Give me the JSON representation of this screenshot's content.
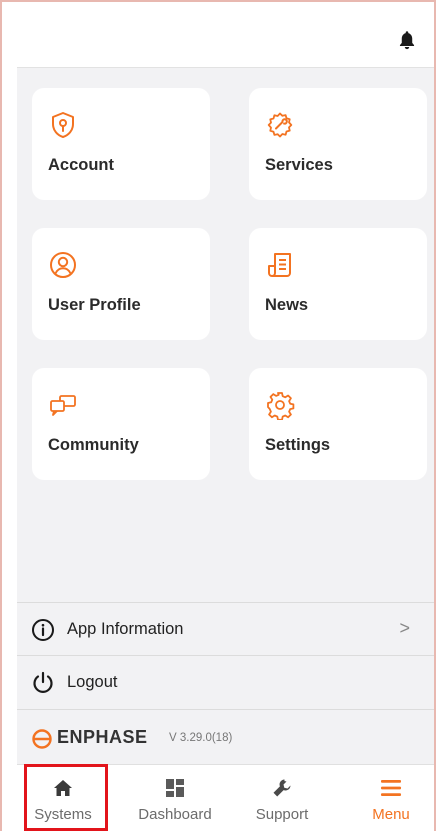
{
  "colors": {
    "accent": "#f37321",
    "highlight_box": "#e2141b",
    "background": "#f2f2f4"
  },
  "header": {
    "icon": "bell-icon"
  },
  "cards": [
    {
      "label": "Account",
      "icon": "shield-key-icon"
    },
    {
      "label": "Services",
      "icon": "services-gear-icon"
    },
    {
      "label": "User Profile",
      "icon": "user-profile-icon"
    },
    {
      "label": "News",
      "icon": "news-icon"
    },
    {
      "label": "Community",
      "icon": "community-chat-icon"
    },
    {
      "label": "Settings",
      "icon": "settings-gear-icon"
    }
  ],
  "list": [
    {
      "label": "App Information",
      "icon": "info-icon",
      "chevron": ">"
    },
    {
      "label": "Logout",
      "icon": "power-icon"
    }
  ],
  "brand": {
    "name": "ENPHASE",
    "version": "V 3.29.0(18)"
  },
  "tabs": [
    {
      "label": "Systems",
      "icon": "home-icon",
      "highlighted": true
    },
    {
      "label": "Dashboard",
      "icon": "dashboard-icon"
    },
    {
      "label": "Support",
      "icon": "wrench-icon"
    },
    {
      "label": "Menu",
      "icon": "hamburger-menu-icon",
      "active": true
    }
  ]
}
